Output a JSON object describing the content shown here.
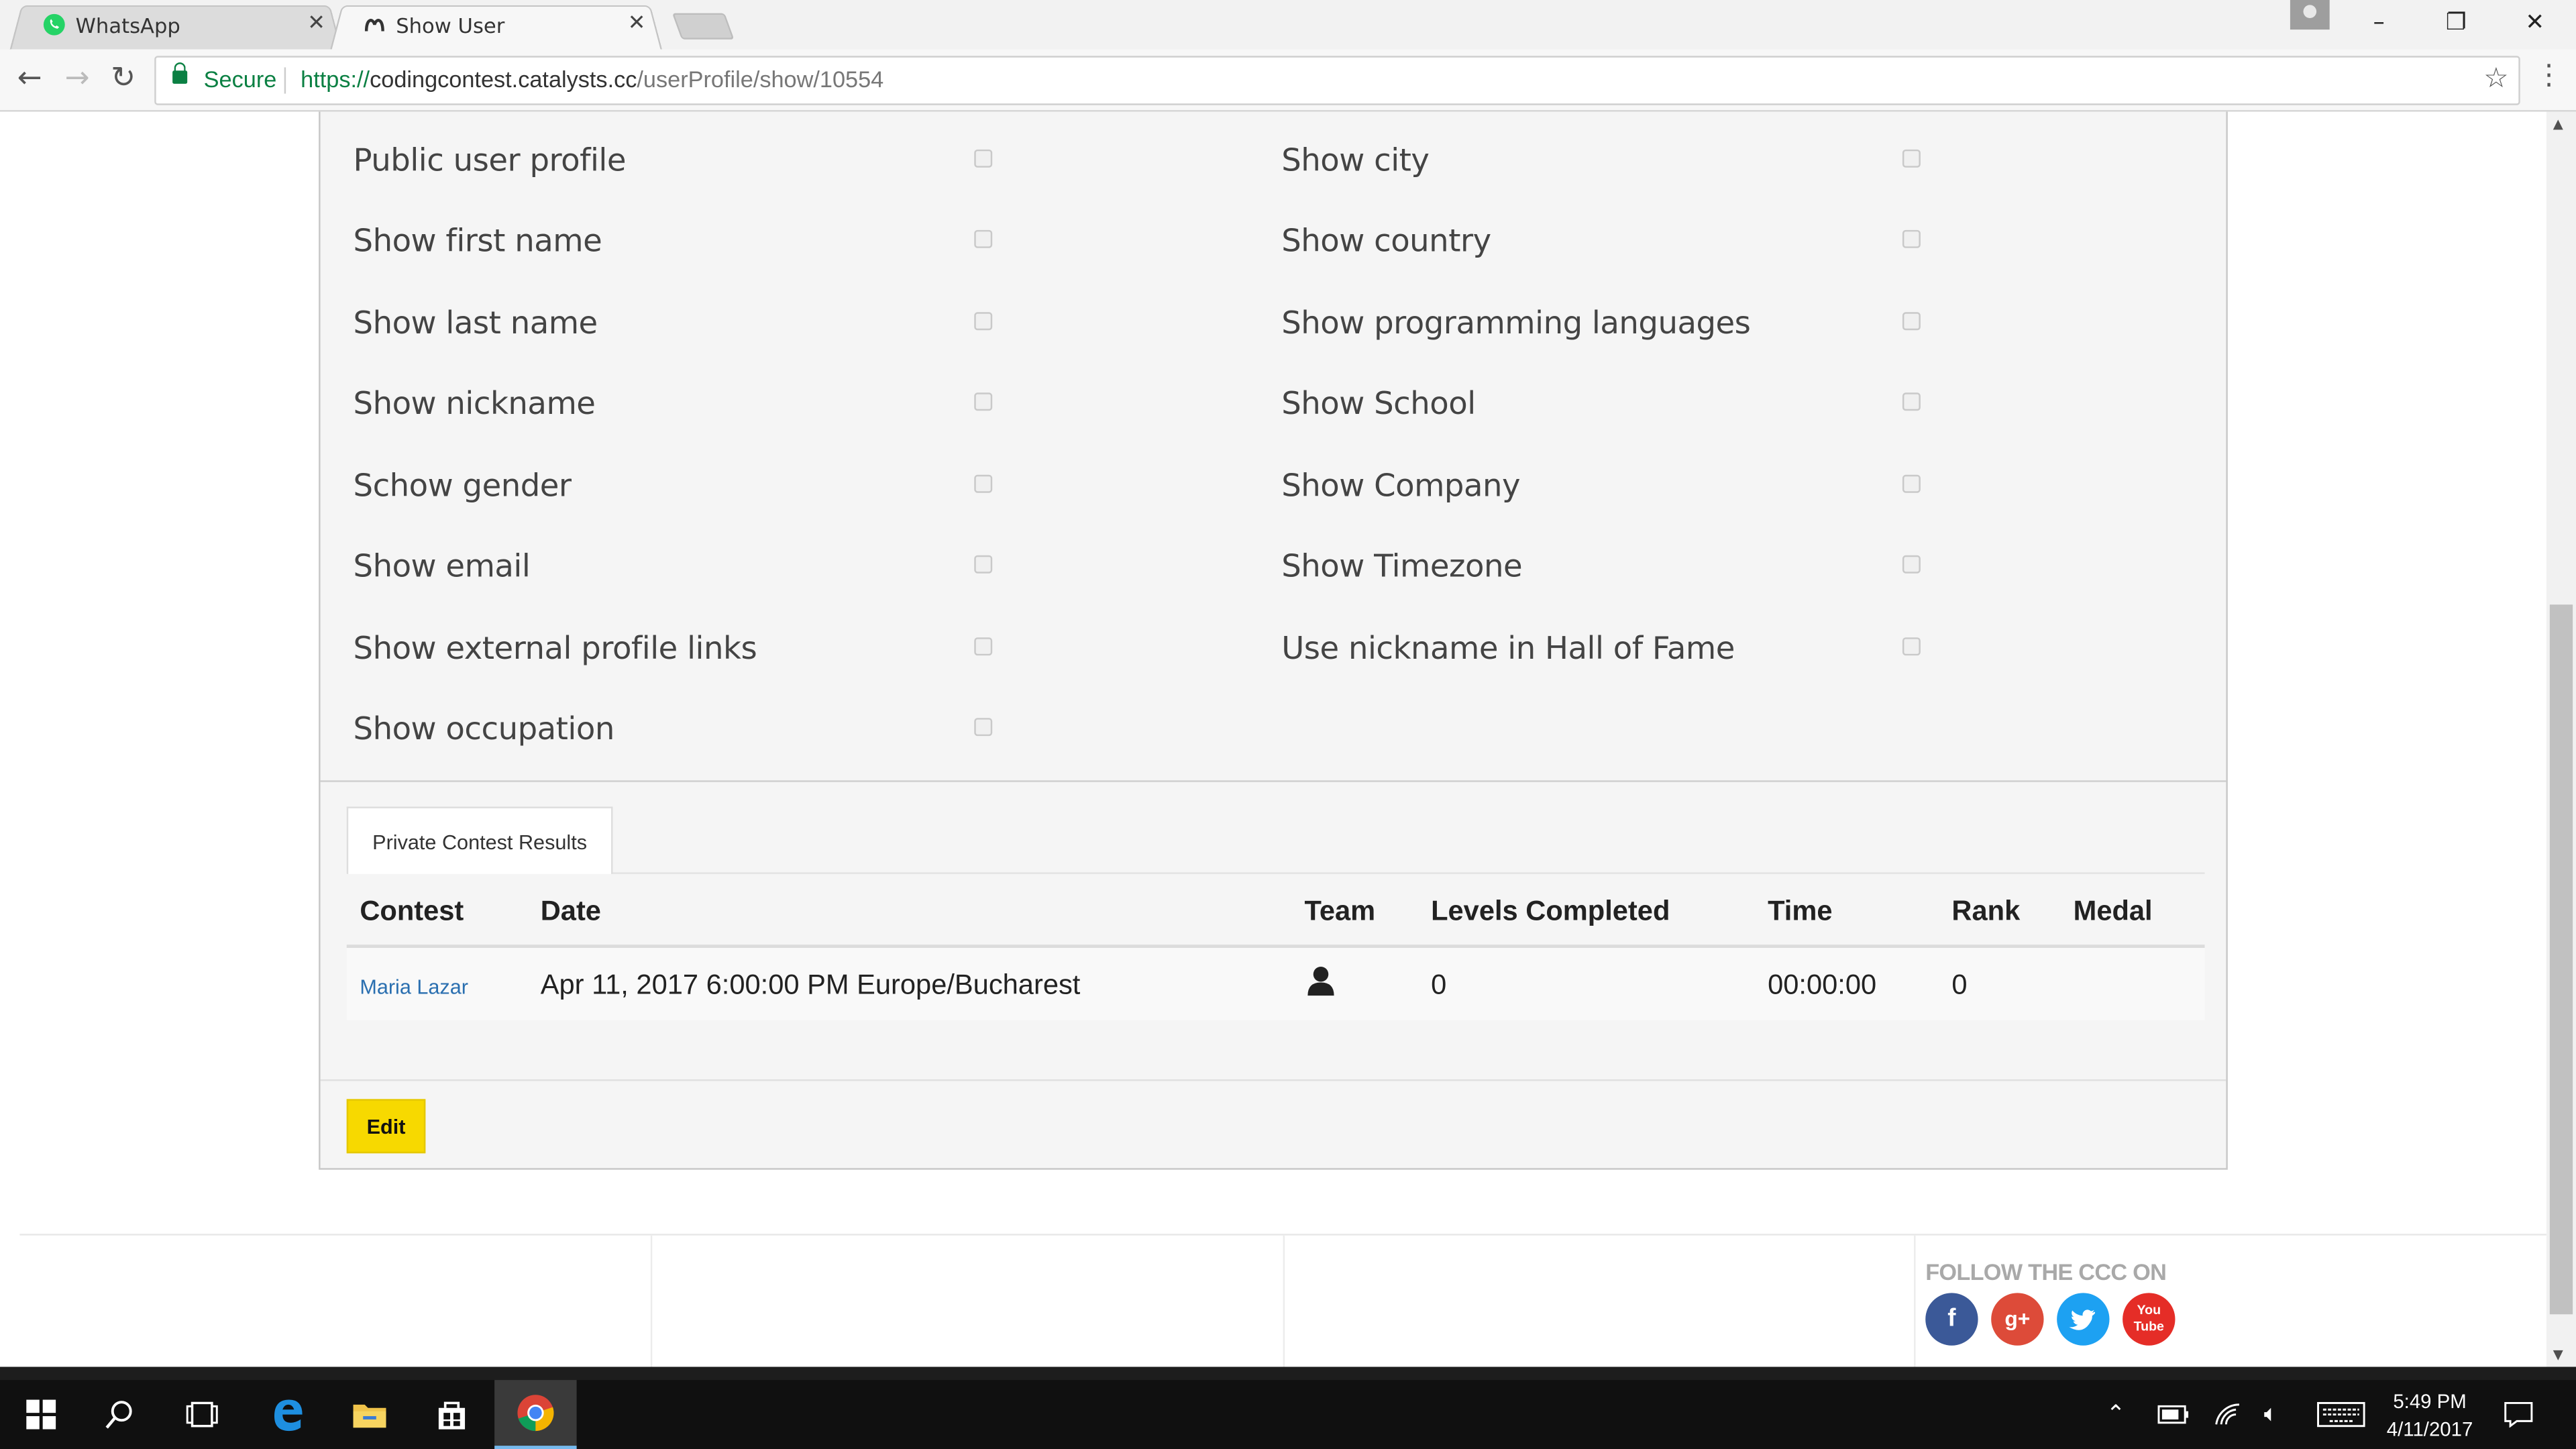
{
  "browser": {
    "tabs": [
      {
        "title": "WhatsApp",
        "active": false,
        "favicon": "whatsapp-icon"
      },
      {
        "title": "Show User",
        "active": true,
        "favicon": "catalysts-icon"
      }
    ],
    "security_label": "Secure",
    "url_scheme": "https://",
    "url_host": "codingcontest.catalysts.cc",
    "url_path": "/userProfile/show/10554"
  },
  "preferences": {
    "left": [
      {
        "label": "Public user profile",
        "checked": false
      },
      {
        "label": "Show first name",
        "checked": false
      },
      {
        "label": "Show last name",
        "checked": false
      },
      {
        "label": "Show nickname",
        "checked": false
      },
      {
        "label": "Schow gender",
        "checked": false
      },
      {
        "label": "Show email",
        "checked": false
      },
      {
        "label": "Show external profile links",
        "checked": false
      },
      {
        "label": "Show occupation",
        "checked": false
      }
    ],
    "right": [
      {
        "label": "Show city",
        "checked": false
      },
      {
        "label": "Show country",
        "checked": false
      },
      {
        "label": "Show programming languages",
        "checked": false
      },
      {
        "label": "Show School",
        "checked": false
      },
      {
        "label": "Show Company",
        "checked": false
      },
      {
        "label": "Show Timezone",
        "checked": false
      },
      {
        "label": "Use nickname in Hall of Fame",
        "checked": false
      }
    ]
  },
  "results": {
    "tab_label": "Private Contest Results",
    "columns": [
      "Contest",
      "Date",
      "Team",
      "Levels Completed",
      "Time",
      "Rank",
      "Medal"
    ],
    "rows": [
      {
        "contest": "Maria Lazar",
        "date": "Apr 11, 2017 6:00:00 PM Europe/Bucharest",
        "team_icon": "person-icon",
        "levels": "0",
        "time": "00:00:00",
        "rank": "0",
        "medal": ""
      }
    ]
  },
  "edit_label": "Edit",
  "footer": {
    "follow_label": "FOLLOW THE CCC ON",
    "social": [
      {
        "name": "facebook",
        "glyph": "f",
        "color": "#3b5998"
      },
      {
        "name": "google-plus",
        "glyph": "g+",
        "color": "#dd4b39"
      },
      {
        "name": "twitter",
        "glyph": "t",
        "color": "#1da1f2"
      },
      {
        "name": "youtube",
        "glyph": "You Tube",
        "color": "#e52d27"
      }
    ]
  },
  "taskbar": {
    "time": "5:49 PM",
    "date": "4/11/2017"
  }
}
